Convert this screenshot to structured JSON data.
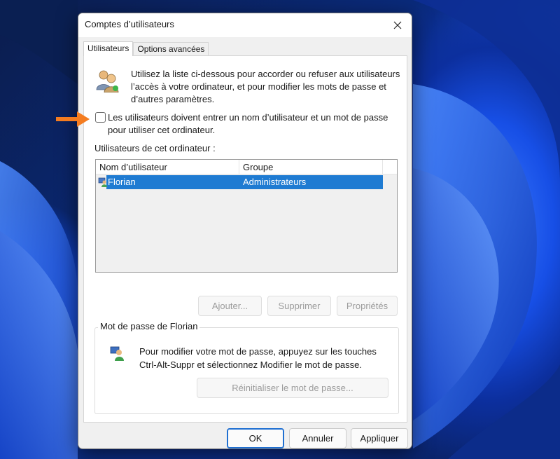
{
  "window": {
    "title": "Comptes d’utilisateurs"
  },
  "tabs": [
    {
      "label": "Utilisateurs",
      "active": true
    },
    {
      "label": "Options avancées",
      "active": false
    }
  ],
  "intro": {
    "text": "Utilisez la liste ci-dessous pour accorder ou refuser aux utilisateurs l’accès à votre ordinateur, et pour modifier les mots de passe et d’autres paramètres."
  },
  "require_login": {
    "label": "Les utilisateurs doivent entrer un nom d’utilisateur et un mot de passe pour utiliser cet ordinateur.",
    "checked": false
  },
  "users_list": {
    "label": "Utilisateurs de cet ordinateur :",
    "columns": [
      "Nom d’utilisateur",
      "Groupe"
    ],
    "rows": [
      {
        "name": "Florian",
        "group": "Administrateurs",
        "selected": true
      }
    ]
  },
  "list_buttons": {
    "add": "Ajouter...",
    "remove": "Supprimer",
    "properties": "Propriétés"
  },
  "password_group": {
    "title": "Mot de passe de Florian",
    "text": "Pour modifier votre mot de passe, appuyez sur les touches Ctrl-Alt-Suppr et sélectionnez Modifier le mot de passe.",
    "reset_button": "Réinitialiser le mot de passe..."
  },
  "footer": {
    "ok": "OK",
    "cancel": "Annuler",
    "apply": "Appliquer"
  },
  "colors": {
    "selection": "#1f7bd2",
    "accent_arrow": "#f47c20",
    "default_button_border": "#1f6fd1"
  }
}
